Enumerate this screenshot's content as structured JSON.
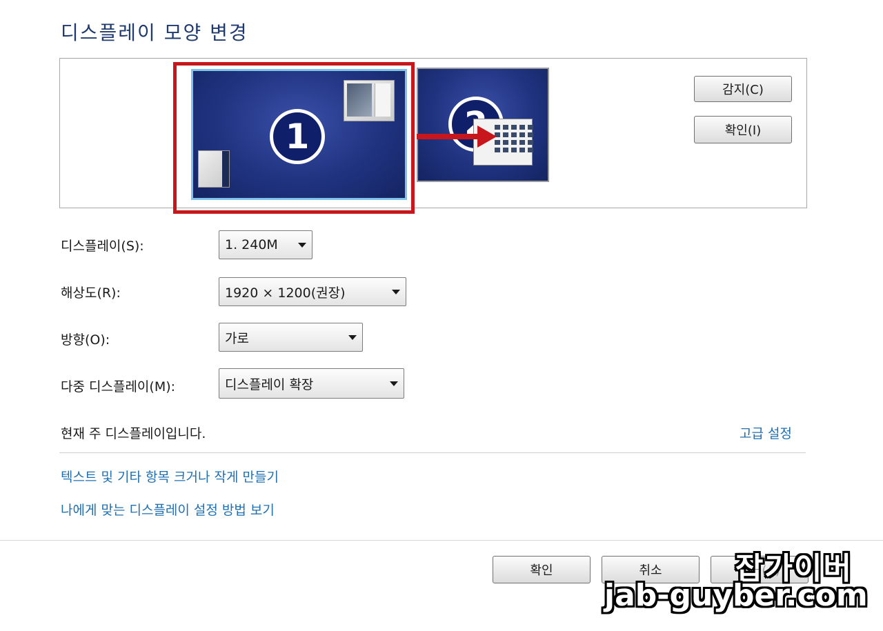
{
  "title": "디스플레이 모양 변경",
  "buttons": {
    "detect": "감지(C)",
    "identify": "확인(I)",
    "ok": "확인",
    "cancel": "취소",
    "apply": "적용(A)"
  },
  "monitors": [
    {
      "number": "1"
    },
    {
      "number": "2"
    }
  ],
  "fields": {
    "display": {
      "label": "디스플레이(S):",
      "value": "1. 240M"
    },
    "resolution": {
      "label": "해상도(R):",
      "value": "1920 × 1200(권장)"
    },
    "orientation": {
      "label": "방향(O):",
      "value": "가로"
    },
    "multi_display": {
      "label": "다중 디스플레이(M):",
      "value": "디스플레이 확장"
    }
  },
  "status_text": "현재 주 디스플레이입니다.",
  "links": {
    "advanced": "고급 설정",
    "text_size": "텍스트 및 기타 항목 크거나 작게 만들기",
    "help": "나에게 맞는 디스플레이 설정 방법 보기"
  },
  "watermark": {
    "line1": "잡가이버",
    "line2": "jab-guyber.com"
  },
  "colors": {
    "highlight": "#c8161d",
    "link": "#1f6fb0",
    "monitor": "#203380"
  },
  "icons": [
    "monitor-arrow-icon",
    "dropdown-caret-icon"
  ]
}
